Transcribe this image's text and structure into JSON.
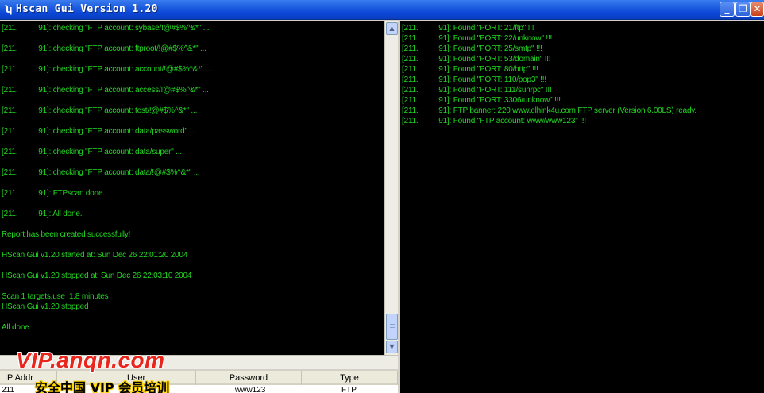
{
  "window": {
    "title": "Hscan Gui Version 1.20",
    "icon": "hscan-app-icon",
    "min_glyph": "_",
    "max_glyph": "❐",
    "close_glyph": "✕"
  },
  "left_log": [
    "[211.          91]: checking \"FTP account: sybase/!@#$%^&*\" ...",
    "[211.          91]: checking \"FTP account: ftproot/!@#$%^&*\" ...",
    "[211.          91]: checking \"FTP account: account/!@#$%^&*\" ...",
    "[211.          91]: checking \"FTP account: access/!@#$%^&*\" ...",
    "[211.          91]: checking \"FTP account: test/!@#$%^&*\" ...",
    "[211.          91]: checking \"FTP account: data/password\" ...",
    "[211.          91]: checking \"FTP account: data/super\" ...",
    "[211.          91]: checking \"FTP account: data/!@#$%^&*\" ...",
    "[211.          91]: FTPscan done.",
    "[211.          91]: All done.",
    "Report has been created successfully!",
    "HScan Gui v1.20 started at: Sun Dec 26 22:01:20 2004",
    "HScan Gui v1.20 stopped at: Sun Dec 26 22:03:10 2004",
    "Scan 1 targets,use  1.8 minutes",
    "HScan Gui v1.20 stopped",
    "All done"
  ],
  "right_log": [
    "[211.          91]: Found \"PORT: 21/ftp\" !!!",
    "[211.          91]: Found \"PORT: 22/unknow\" !!!",
    "[211.          91]: Found \"PORT: 25/smtp\" !!!",
    "[211.          91]: Found \"PORT: 53/domain\" !!!",
    "[211.          91]: Found \"PORT: 80/http\" !!!",
    "[211.          91]: Found \"PORT: 110/pop3\" !!!",
    "[211.          91]: Found \"PORT: 111/sunrpc\" !!!",
    "[211.          91]: Found \"PORT: 3306/unknow\" !!!",
    "[211.          91]: FTP banner: 220 www.elhink4u.com FTP server (Version 6.00LS) ready.",
    "[211.          91]: Found \"FTP account: www/www123\" !!!"
  ],
  "table": {
    "columns": [
      "IP Addr",
      "User",
      "Password",
      "Type"
    ],
    "rows": [
      {
        "ip": "211",
        "user": "",
        "password": "www123",
        "type": "FTP"
      }
    ]
  },
  "watermark": {
    "url": "VIP.anqn.com",
    "caption": "安全中国 VIP 会员培训"
  },
  "colors": {
    "log_text": "#23d823",
    "log_background": "#000000",
    "titlebar": "#0a46d6",
    "watermark_red": "#e9261d"
  }
}
